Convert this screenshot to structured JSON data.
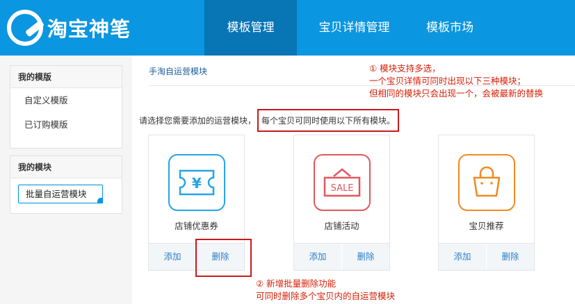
{
  "header": {
    "logo_text": "淘宝神笔",
    "nav": [
      {
        "label": "模板管理",
        "active": true
      },
      {
        "label": "宝贝详情管理",
        "active": false
      },
      {
        "label": "模板市场",
        "active": false
      }
    ]
  },
  "sidebar": {
    "sections": [
      {
        "title": "我的模版",
        "items": [
          "自定义模版",
          "已订购模版"
        ]
      },
      {
        "title": "我的模块",
        "items": [
          "批量自运营模块"
        ]
      }
    ]
  },
  "main": {
    "title": "手淘自运营模块",
    "instruction": "请选择您需要添加的运营模块，",
    "note": "每个宝贝可同时使用以下所有模块。",
    "cards": [
      {
        "label": "店铺优惠券",
        "icon": "coupon-icon",
        "icon_text": "¥",
        "color": "#26a3e8",
        "add": "添加",
        "delete": "删除"
      },
      {
        "label": "店铺活动",
        "icon": "sale-icon",
        "icon_text": "SALE",
        "color": "#e2575b",
        "add": "添加",
        "delete": "删除"
      },
      {
        "label": "宝贝推荐",
        "icon": "shopping-bag-icon",
        "icon_text": "",
        "color": "#f0891f",
        "add": "添加",
        "delete": "删除"
      }
    ]
  },
  "annotations": {
    "first": [
      "① 模块支持多选，",
      "一个宝贝详情可同时出现以下三种模块；",
      "但相同的模块只会出现一个，会被最新的替换"
    ],
    "second": [
      "② 新增批量删除功能",
      "可同时删除多个宝贝内的自运营模块"
    ]
  },
  "colors": {
    "brand": "#0a96e0",
    "nav_active": "#0875b5",
    "annotation": "#d81e06"
  }
}
